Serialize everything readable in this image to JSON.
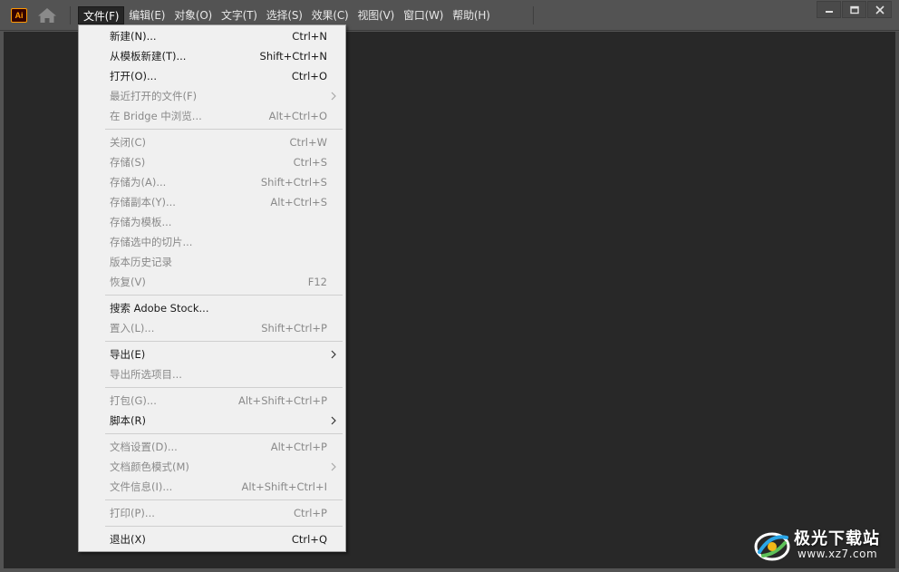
{
  "app": {
    "logo_text": "Ai"
  },
  "menubar": {
    "items": [
      "文件(F)",
      "编辑(E)",
      "对象(O)",
      "文字(T)",
      "选择(S)",
      "效果(C)",
      "视图(V)",
      "窗口(W)",
      "帮助(H)"
    ],
    "active_index": 0
  },
  "file_menu": {
    "items": [
      {
        "label": "新建(N)...",
        "shortcut": "Ctrl+N",
        "enabled": true
      },
      {
        "label": "从模板新建(T)...",
        "shortcut": "Shift+Ctrl+N",
        "enabled": true
      },
      {
        "label": "打开(O)...",
        "shortcut": "Ctrl+O",
        "enabled": true
      },
      {
        "label": "最近打开的文件(F)",
        "shortcut": "",
        "enabled": false,
        "submenu": true
      },
      {
        "label": "在 Bridge 中浏览...",
        "shortcut": "Alt+Ctrl+O",
        "enabled": false
      },
      {
        "label": "关闭(C)",
        "shortcut": "Ctrl+W",
        "enabled": false
      },
      {
        "label": "存储(S)",
        "shortcut": "Ctrl+S",
        "enabled": false
      },
      {
        "label": "存储为(A)...",
        "shortcut": "Shift+Ctrl+S",
        "enabled": false
      },
      {
        "label": "存储副本(Y)...",
        "shortcut": "Alt+Ctrl+S",
        "enabled": false
      },
      {
        "label": "存储为模板...",
        "shortcut": "",
        "enabled": false
      },
      {
        "label": "存储选中的切片...",
        "shortcut": "",
        "enabled": false
      },
      {
        "label": "版本历史记录",
        "shortcut": "",
        "enabled": false
      },
      {
        "label": "恢复(V)",
        "shortcut": "F12",
        "enabled": false
      },
      {
        "label": "搜索 Adobe Stock...",
        "shortcut": "",
        "enabled": true
      },
      {
        "label": "置入(L)...",
        "shortcut": "Shift+Ctrl+P",
        "enabled": false
      },
      {
        "label": "导出(E)",
        "shortcut": "",
        "enabled": true,
        "submenu": true
      },
      {
        "label": "导出所选项目...",
        "shortcut": "",
        "enabled": false
      },
      {
        "label": "打包(G)...",
        "shortcut": "Alt+Shift+Ctrl+P",
        "enabled": false
      },
      {
        "label": "脚本(R)",
        "shortcut": "",
        "enabled": true,
        "submenu": true
      },
      {
        "label": "文档设置(D)...",
        "shortcut": "Alt+Ctrl+P",
        "enabled": false
      },
      {
        "label": "文档颜色模式(M)",
        "shortcut": "",
        "enabled": false,
        "submenu": true
      },
      {
        "label": "文件信息(I)...",
        "shortcut": "Alt+Shift+Ctrl+I",
        "enabled": false
      },
      {
        "label": "打印(P)...",
        "shortcut": "Ctrl+P",
        "enabled": false
      },
      {
        "label": "退出(X)",
        "shortcut": "Ctrl+Q",
        "enabled": true
      }
    ]
  },
  "watermark": {
    "title": "极光下载站",
    "url": "www.xz7.com"
  },
  "colors": {
    "chrome": "#535353",
    "workspace": "#282828",
    "menu_bg": "#f0f0f0",
    "menu_text": "#1a1a1a",
    "menu_disabled": "#8a8a8a",
    "ai_orange": "#ff9a00"
  }
}
